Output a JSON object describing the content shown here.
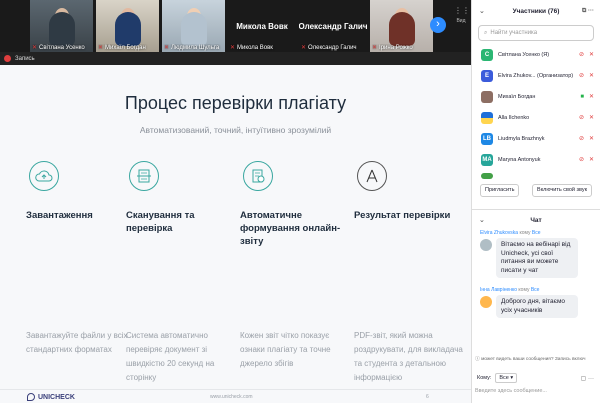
{
  "video_strip": {
    "tiles": [
      {
        "name": "Світлана Усенко",
        "muted": true
      },
      {
        "name": "Михаїл Богдан",
        "muted": true
      },
      {
        "name": "Людмила Шульга",
        "muted": true
      },
      {
        "name": "Микола Вовк",
        "muted": true
      },
      {
        "name": "Олександр Галич",
        "muted": true
      },
      {
        "name": "Ірина Рожко",
        "muted": true
      }
    ],
    "big_names": [
      "Микола Вовк",
      "Олександр Галич"
    ],
    "next_glyph": "›",
    "menu_glyph": "⋮⋮",
    "menu_label": "Вид"
  },
  "share_bar": {
    "label": "Запись"
  },
  "slide": {
    "title": "Процес перевірки плагіату",
    "subtitle": "Автоматизований, точний, інтуїтивно зрозумілий",
    "columns": [
      {
        "icon": "cloud-upload-icon",
        "title": "Завантаження",
        "desc": "Завантажуйте файли у всіх стандартних форматах"
      },
      {
        "icon": "scan-document-icon",
        "title": "Сканування та перевірка",
        "desc": "Система автоматично перевіряє документ зі швидкістю 20 секунд на сторінку"
      },
      {
        "icon": "report-document-icon",
        "title": "Автоматичне формування онлайн-звіту",
        "desc": "Кожен звіт чітко показує ознаки плагіату та точне джерело збігів"
      },
      {
        "icon": "pen-nib-icon",
        "title": "Результат перевірки",
        "desc": "PDF-звіт, який можна роздрукувати, для викладача та студента з детальною інформацією"
      }
    ],
    "logo_text": "UNICHECK",
    "footer_url": "www.unicheck.com",
    "page_number": "6"
  },
  "participants": {
    "header": "Участники (76)",
    "search_placeholder": "Найти участника",
    "list": [
      {
        "initials": "С",
        "color": "#2bb673",
        "name": "Світлана Усенко (Я)",
        "video": "red",
        "mic": "red"
      },
      {
        "initials": "E",
        "color": "#3b5bdb",
        "name": "Elvira Zhukov... (Организатор)",
        "video": "red",
        "mic": "red"
      },
      {
        "initials": "",
        "color": "#8d6e63",
        "name": "Михаїл Богдан",
        "video": "green",
        "mic": "red"
      },
      {
        "initials": "",
        "color": "#ffd54f",
        "name": "Alla Ilchenko",
        "video": "red",
        "mic": "red"
      },
      {
        "initials": "LB",
        "color": "#1e88e5",
        "name": "Liudmyla Brazhnyk",
        "video": "red",
        "mic": "red"
      },
      {
        "initials": "MA",
        "color": "#26a69a",
        "name": "Maryna Antonyuk",
        "video": "red",
        "mic": "red"
      },
      {
        "initials": "",
        "color": "#43a047",
        "name": "",
        "video": "",
        "mic": ""
      }
    ],
    "invite_label": "Пригласить",
    "unmute_self_label": "Включить свой звук",
    "tools_label": "⧉ ···"
  },
  "chat": {
    "header": "Чат",
    "messages": [
      {
        "from": "Elvira Zhukovska",
        "to_prefix": "кому",
        "to": "Все",
        "avatar_color": "#b0bec5",
        "text": "Вітаємо на вебінарі від Unicheck, усі свої питання ви можете писати у чат"
      },
      {
        "from": "Інна Лавріненко",
        "to_prefix": "кому",
        "to": "Все",
        "avatar_color": "#ffb74d",
        "text": "Доброго дня, вітаємо усіх учасників"
      }
    ],
    "notice": "ⓘ может видеть ваши сообщения? Запись включ",
    "to_label": "Кому:",
    "to_value": "Все ▾",
    "more_glyph": "▢ ···",
    "input_placeholder": "Введите здесь сообщение..."
  }
}
